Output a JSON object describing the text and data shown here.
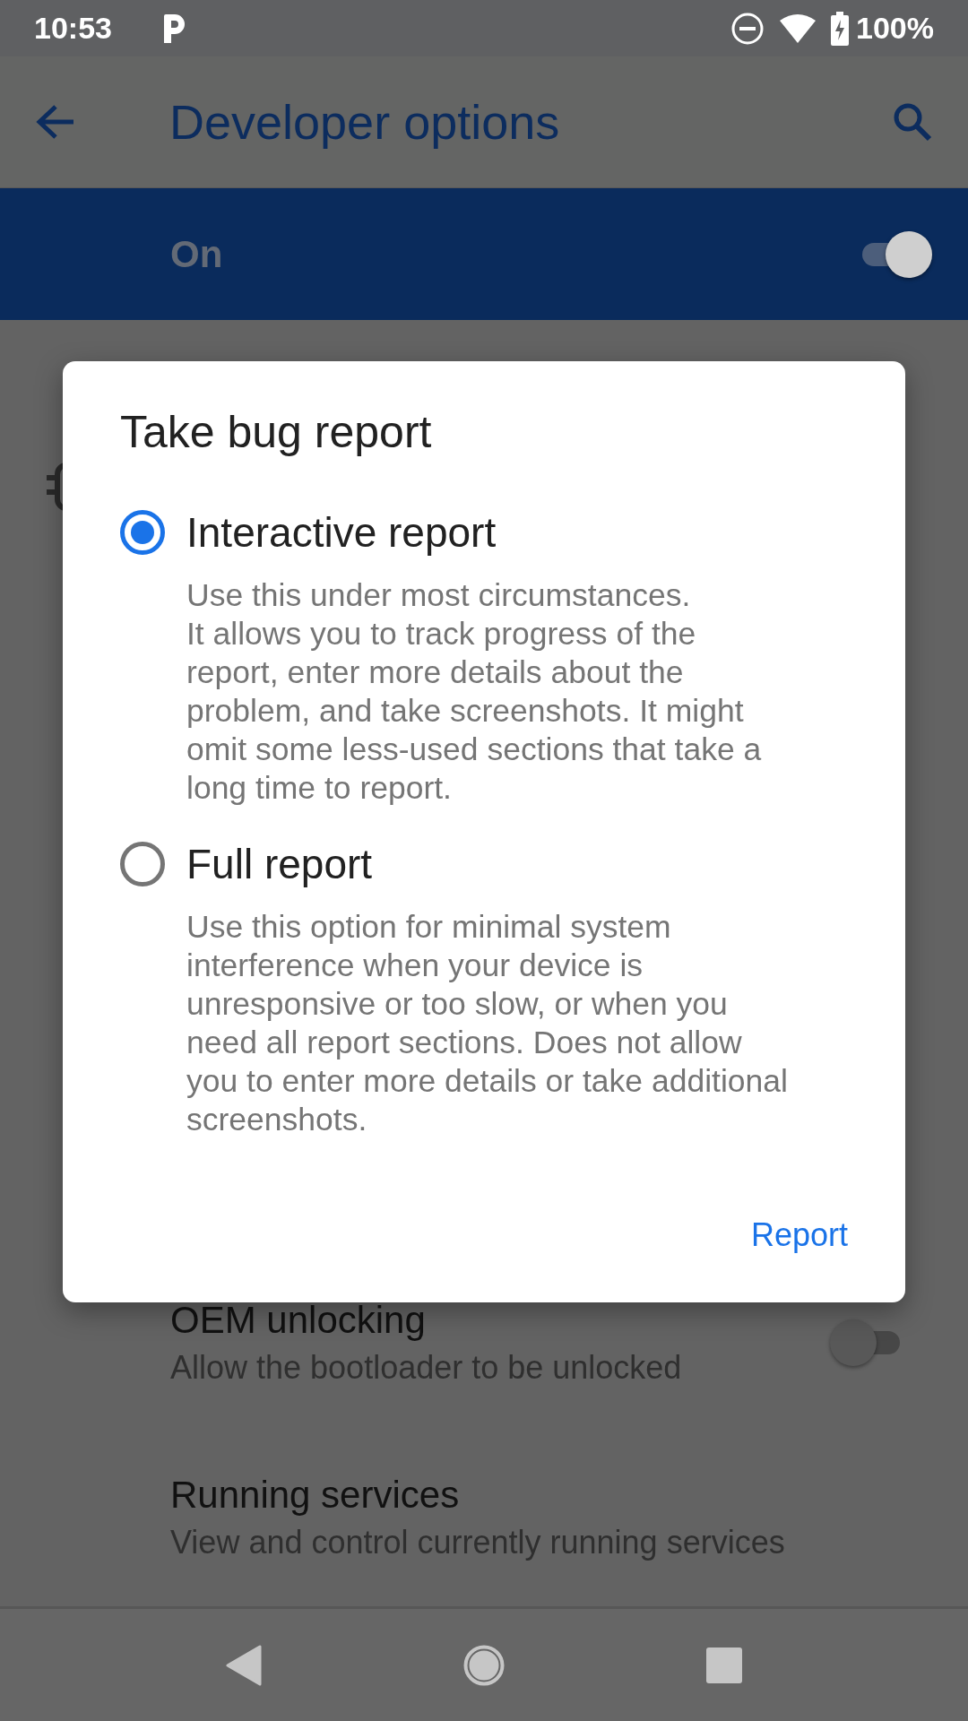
{
  "status_bar": {
    "time": "10:53",
    "battery": "100%"
  },
  "app_bar": {
    "title": "Developer options"
  },
  "master_switch": {
    "label": "On",
    "on": true
  },
  "settings": [
    {
      "title": "OEM unlocking",
      "summary": "Allow the bootloader to be unlocked",
      "kind": "toggle",
      "on": false
    },
    {
      "title": "Running services",
      "summary": "View and control currently running services",
      "kind": "plain"
    }
  ],
  "dialog": {
    "title": "Take bug report",
    "options": [
      {
        "label": "Interactive report",
        "description": "Use this under most circumstances.\nIt allows you to track progress of the report, enter more details about the problem, and take screenshots. It might omit some less-used sections that take a long time to report.",
        "selected": true
      },
      {
        "label": "Full report",
        "description": "Use this option for minimal system interference when your device is unresponsive or too slow, or when you need all report sections. Does not allow you to enter more details or take additional screenshots.",
        "selected": false
      }
    ],
    "buttons": [
      "Report"
    ]
  }
}
